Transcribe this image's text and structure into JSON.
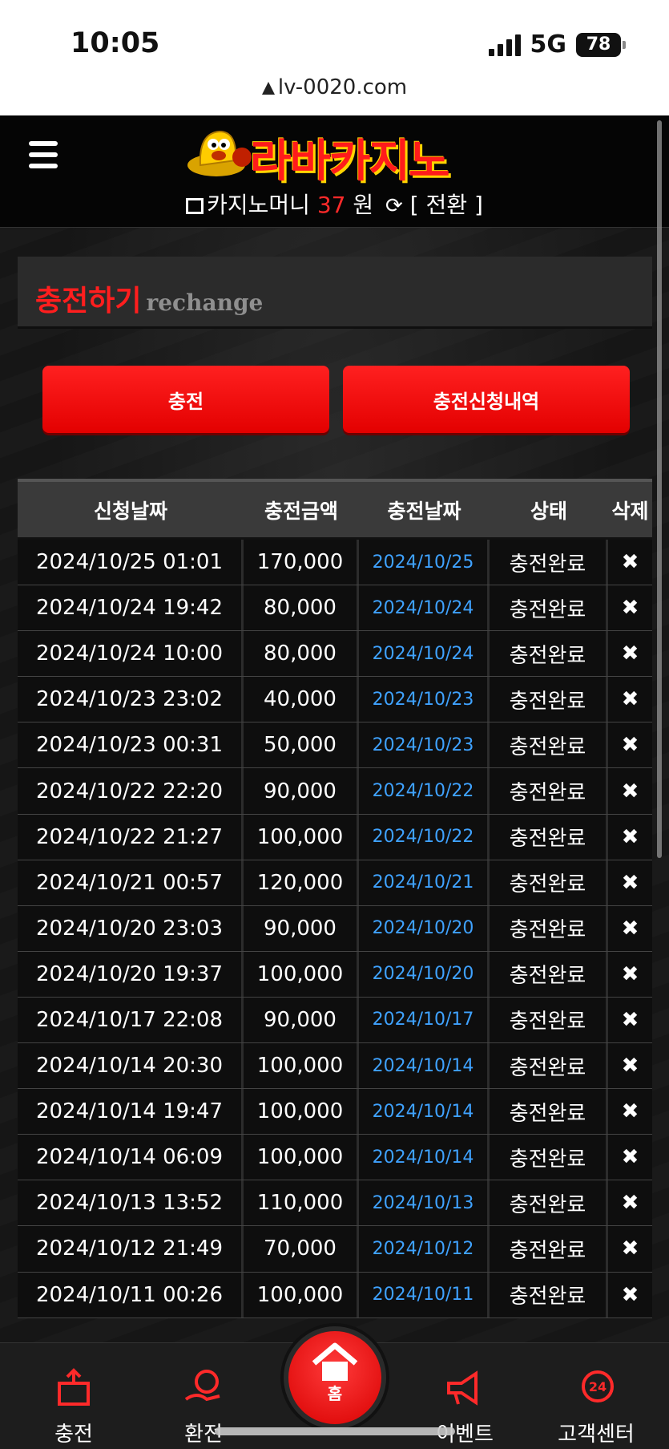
{
  "status_bar": {
    "time": "10:05",
    "network": "5G",
    "battery": "78"
  },
  "url": "lv-0020.com",
  "header": {
    "logo_text": "라바카지노",
    "money_label": "카지노머니",
    "money_amount": "37",
    "money_unit": "원",
    "switch_label": "[ 전환 ]"
  },
  "panel": {
    "title": "충전하기",
    "subtitle": "rechange"
  },
  "buttons": {
    "charge": "충전",
    "history": "충전신청내역"
  },
  "table": {
    "columns": [
      "신청날짜",
      "충전금액",
      "충전날짜",
      "상태",
      "삭제"
    ],
    "rows": [
      {
        "requested": "2024/10/25 01:01",
        "amount": "170,000",
        "charged": "2024/10/25",
        "status": "충전완료",
        "delete": "✖"
      },
      {
        "requested": "2024/10/24 19:42",
        "amount": "80,000",
        "charged": "2024/10/24",
        "status": "충전완료",
        "delete": "✖"
      },
      {
        "requested": "2024/10/24 10:00",
        "amount": "80,000",
        "charged": "2024/10/24",
        "status": "충전완료",
        "delete": "✖"
      },
      {
        "requested": "2024/10/23 23:02",
        "amount": "40,000",
        "charged": "2024/10/23",
        "status": "충전완료",
        "delete": "✖"
      },
      {
        "requested": "2024/10/23 00:31",
        "amount": "50,000",
        "charged": "2024/10/23",
        "status": "충전완료",
        "delete": "✖"
      },
      {
        "requested": "2024/10/22 22:20",
        "amount": "90,000",
        "charged": "2024/10/22",
        "status": "충전완료",
        "delete": "✖"
      },
      {
        "requested": "2024/10/22 21:27",
        "amount": "100,000",
        "charged": "2024/10/22",
        "status": "충전완료",
        "delete": "✖"
      },
      {
        "requested": "2024/10/21 00:57",
        "amount": "120,000",
        "charged": "2024/10/21",
        "status": "충전완료",
        "delete": "✖"
      },
      {
        "requested": "2024/10/20 23:03",
        "amount": "90,000",
        "charged": "2024/10/20",
        "status": "충전완료",
        "delete": "✖"
      },
      {
        "requested": "2024/10/20 19:37",
        "amount": "100,000",
        "charged": "2024/10/20",
        "status": "충전완료",
        "delete": "✖"
      },
      {
        "requested": "2024/10/17 22:08",
        "amount": "90,000",
        "charged": "2024/10/17",
        "status": "충전완료",
        "delete": "✖"
      },
      {
        "requested": "2024/10/14 20:30",
        "amount": "100,000",
        "charged": "2024/10/14",
        "status": "충전완료",
        "delete": "✖"
      },
      {
        "requested": "2024/10/14 19:47",
        "amount": "100,000",
        "charged": "2024/10/14",
        "status": "충전완료",
        "delete": "✖"
      },
      {
        "requested": "2024/10/14 06:09",
        "amount": "100,000",
        "charged": "2024/10/14",
        "status": "충전완료",
        "delete": "✖"
      },
      {
        "requested": "2024/10/13 13:52",
        "amount": "110,000",
        "charged": "2024/10/13",
        "status": "충전완료",
        "delete": "✖"
      },
      {
        "requested": "2024/10/12 21:49",
        "amount": "70,000",
        "charged": "2024/10/12",
        "status": "충전완료",
        "delete": "✖"
      },
      {
        "requested": "2024/10/11 00:26",
        "amount": "100,000",
        "charged": "2024/10/11",
        "status": "충전완료",
        "delete": "✖"
      }
    ]
  },
  "bottom_nav": {
    "charge": "충전",
    "exchange": "환전",
    "home": "홈",
    "event": "이벤트",
    "support": "고객센터"
  },
  "colors": {
    "accent_red": "#ff1e1e",
    "date_blue": "#3fa2ff",
    "background": "#151515"
  }
}
